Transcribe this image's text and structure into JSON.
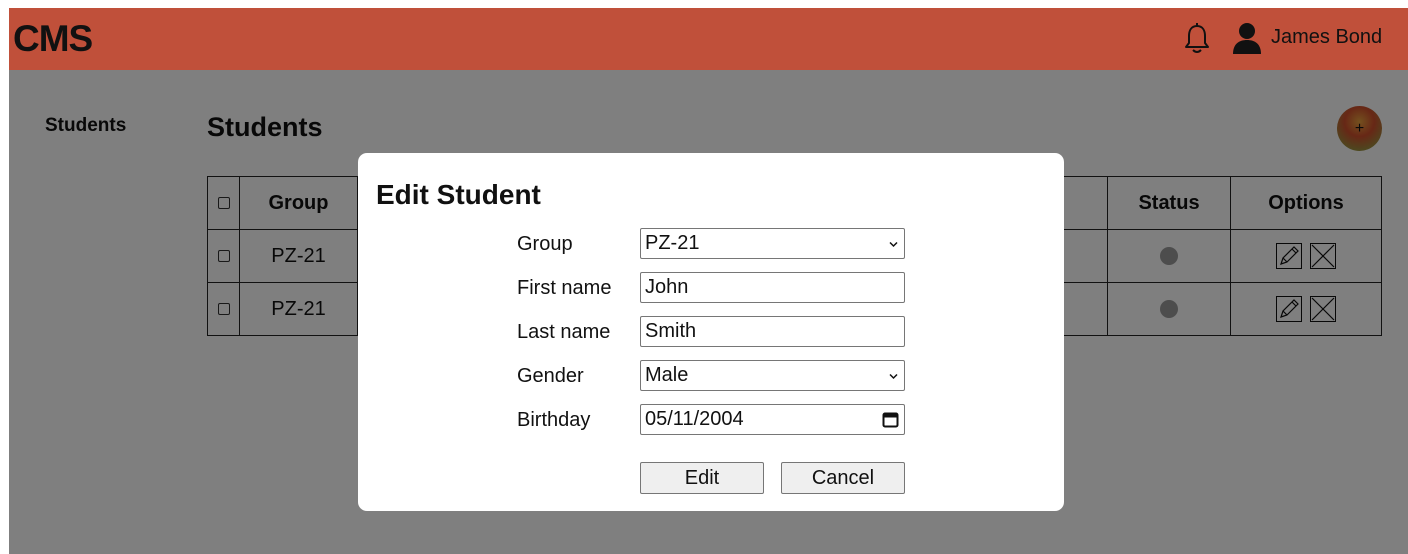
{
  "header": {
    "logo": "CMS",
    "bell_icon": "bell-icon",
    "user_icon": "user-icon",
    "user_name": "James Bond",
    "background_color": "#c0503a"
  },
  "sidebar": {
    "items": [
      {
        "label": "Students"
      }
    ]
  },
  "page": {
    "title": "Students",
    "add_button_label": "+"
  },
  "table": {
    "columns": [
      "",
      "Group",
      "",
      "",
      "",
      "Status",
      "Options"
    ],
    "rows": [
      {
        "group": "PZ-21",
        "status": "inactive"
      },
      {
        "group": "PZ-21",
        "status": "inactive"
      }
    ],
    "option_icons": [
      "edit-pencil-icon",
      "delete-x-icon"
    ]
  },
  "modal": {
    "title": "Edit Student",
    "fields": {
      "group": {
        "label": "Group",
        "value": "PZ-21"
      },
      "first_name": {
        "label": "First name",
        "value": "John"
      },
      "last_name": {
        "label": "Last name",
        "value": "Smith"
      },
      "gender": {
        "label": "Gender",
        "value": "Male"
      },
      "birthday": {
        "label": "Birthday",
        "value": "05/11/2004"
      }
    },
    "edit_label": "Edit",
    "cancel_label": "Cancel"
  },
  "colors": {
    "overlay": "rgba(0,0,0,0.5)",
    "status_dot": "#9a9a9a"
  }
}
